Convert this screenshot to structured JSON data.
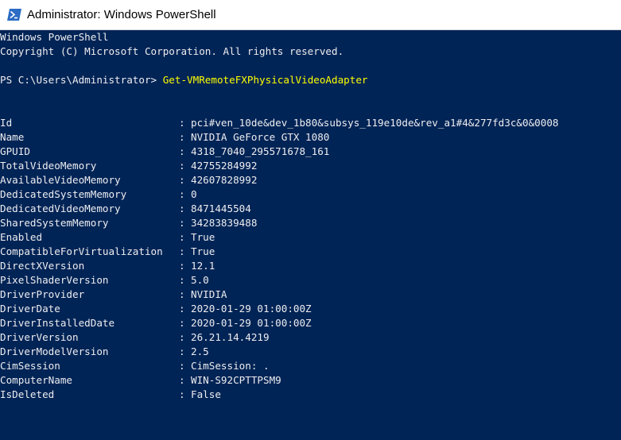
{
  "window": {
    "title": "Administrator: Windows PowerShell",
    "icon": "powershell-icon",
    "title_bar_color": "#ffffff",
    "console_background": "#012456",
    "console_foreground": "#eeedf0",
    "command_color": "#ffff00"
  },
  "console": {
    "header_line1": "Windows PowerShell",
    "header_line2": "Copyright (C) Microsoft Corporation. All rights reserved.",
    "prompt": "PS C:\\Users\\Administrator> ",
    "command": "Get-VMRemoteFXPhysicalVideoAdapter",
    "separator": ":",
    "properties": [
      {
        "name": "Id",
        "value": "pci#ven_10de&dev_1b80&subsys_119e10de&rev_a1#4&277fd3c&0&0008"
      },
      {
        "name": "Name",
        "value": "NVIDIA GeForce GTX 1080"
      },
      {
        "name": "GPUID",
        "value": "4318_7040_295571678_161"
      },
      {
        "name": "TotalVideoMemory",
        "value": "42755284992"
      },
      {
        "name": "AvailableVideoMemory",
        "value": "42607828992"
      },
      {
        "name": "DedicatedSystemMemory",
        "value": "0"
      },
      {
        "name": "DedicatedVideoMemory",
        "value": "8471445504"
      },
      {
        "name": "SharedSystemMemory",
        "value": "34283839488"
      },
      {
        "name": "Enabled",
        "value": "True"
      },
      {
        "name": "CompatibleForVirtualization",
        "value": "True"
      },
      {
        "name": "DirectXVersion",
        "value": "12.1"
      },
      {
        "name": "PixelShaderVersion",
        "value": "5.0"
      },
      {
        "name": "DriverProvider",
        "value": "NVIDIA"
      },
      {
        "name": "DriverDate",
        "value": "2020-01-29 01:00:00Z"
      },
      {
        "name": "DriverInstalledDate",
        "value": "2020-01-29 01:00:00Z"
      },
      {
        "name": "DriverVersion",
        "value": "26.21.14.4219"
      },
      {
        "name": "DriverModelVersion",
        "value": "2.5"
      },
      {
        "name": "CimSession",
        "value": "CimSession: ."
      },
      {
        "name": "ComputerName",
        "value": "WIN-S92CPTTPSM9"
      },
      {
        "name": "IsDeleted",
        "value": "False"
      }
    ]
  }
}
